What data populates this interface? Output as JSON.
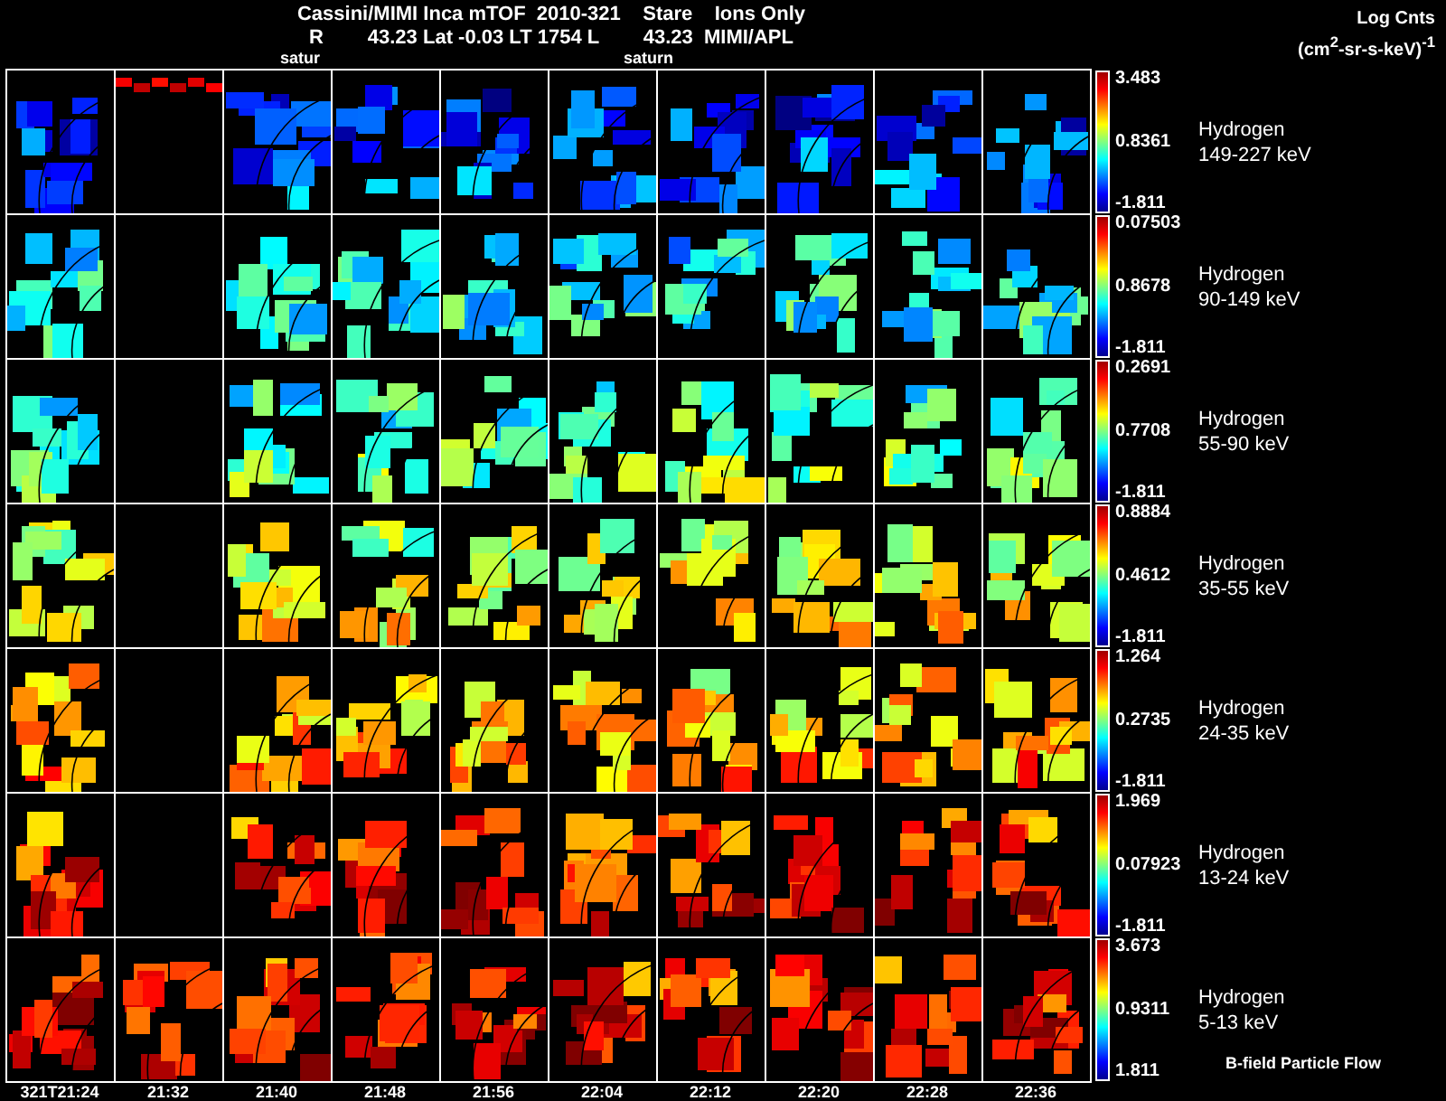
{
  "title": {
    "line1": "Cassini/MIMI Inca mTOF  2010-321    Stare    Ions Only",
    "line2": "R        43.23 Lat -0.03 LT 1754 L        43.23  MIMI/APL",
    "overlays": [
      "satur",
      "saturn"
    ]
  },
  "units": {
    "label": "Log Cnts",
    "unit": "(cm$^{2}$-sr-s-keV)$^{-1}$"
  },
  "rows": [
    {
      "species": "Hydrogen",
      "energy": "149-227 keV",
      "scale_max": "3.483",
      "scale_mid": "0.8361",
      "scale_min": "-1.811",
      "panels": [
        {
          "kind": "full"
        },
        {
          "kind": "strip"
        },
        {
          "kind": "full"
        },
        {
          "kind": "full"
        },
        {
          "kind": "full"
        },
        {
          "kind": "full"
        },
        {
          "kind": "full"
        },
        {
          "kind": "full"
        },
        {
          "kind": "full"
        },
        {
          "kind": "full"
        }
      ]
    },
    {
      "species": "Hydrogen",
      "energy": "90-149 keV",
      "scale_max": "0.07503",
      "scale_mid": "0.8678",
      "scale_min": "-1.811",
      "panels": [
        {
          "kind": "full"
        },
        {
          "kind": "empty"
        },
        {
          "kind": "full"
        },
        {
          "kind": "full"
        },
        {
          "kind": "full"
        },
        {
          "kind": "full"
        },
        {
          "kind": "full"
        },
        {
          "kind": "full"
        },
        {
          "kind": "full"
        },
        {
          "kind": "full"
        }
      ]
    },
    {
      "species": "Hydrogen",
      "energy": "55-90 keV",
      "scale_max": "0.2691",
      "scale_mid": "0.7708",
      "scale_min": "-1.811",
      "panels": [
        {
          "kind": "full"
        },
        {
          "kind": "empty"
        },
        {
          "kind": "full"
        },
        {
          "kind": "full"
        },
        {
          "kind": "full"
        },
        {
          "kind": "full"
        },
        {
          "kind": "full"
        },
        {
          "kind": "full"
        },
        {
          "kind": "full"
        },
        {
          "kind": "full"
        }
      ]
    },
    {
      "species": "Hydrogen",
      "energy": "35-55 keV",
      "scale_max": "0.8884",
      "scale_mid": "0.4612",
      "scale_min": "-1.811",
      "panels": [
        {
          "kind": "full"
        },
        {
          "kind": "empty"
        },
        {
          "kind": "full"
        },
        {
          "kind": "full"
        },
        {
          "kind": "full"
        },
        {
          "kind": "full"
        },
        {
          "kind": "full"
        },
        {
          "kind": "full"
        },
        {
          "kind": "full"
        },
        {
          "kind": "full"
        }
      ]
    },
    {
      "species": "Hydrogen",
      "energy": "24-35 keV",
      "scale_max": "1.264",
      "scale_mid": "0.2735",
      "scale_min": "-1.811",
      "panels": [
        {
          "kind": "full"
        },
        {
          "kind": "empty"
        },
        {
          "kind": "full"
        },
        {
          "kind": "full"
        },
        {
          "kind": "full"
        },
        {
          "kind": "full"
        },
        {
          "kind": "full"
        },
        {
          "kind": "full"
        },
        {
          "kind": "full"
        },
        {
          "kind": "full"
        }
      ]
    },
    {
      "species": "Hydrogen",
      "energy": "13-24 keV",
      "scale_max": "1.969",
      "scale_mid": "0.07923",
      "scale_min": "-1.811",
      "panels": [
        {
          "kind": "full"
        },
        {
          "kind": "empty"
        },
        {
          "kind": "full"
        },
        {
          "kind": "full"
        },
        {
          "kind": "full"
        },
        {
          "kind": "full"
        },
        {
          "kind": "full"
        },
        {
          "kind": "full"
        },
        {
          "kind": "full"
        },
        {
          "kind": "full"
        }
      ]
    },
    {
      "species": "Hydrogen",
      "energy": "5-13 keV",
      "scale_max": "3.673",
      "scale_mid": "0.9311",
      "scale_min": "1.811",
      "panels": [
        {
          "kind": "full"
        },
        {
          "kind": "full"
        },
        {
          "kind": "full"
        },
        {
          "kind": "full"
        },
        {
          "kind": "full"
        },
        {
          "kind": "full"
        },
        {
          "kind": "full"
        },
        {
          "kind": "full"
        },
        {
          "kind": "full"
        },
        {
          "kind": "full"
        }
      ]
    }
  ],
  "footnote": "B-field Particle Flow",
  "times": [
    "321T21:24",
    "21:32",
    "21:40",
    "21:48",
    "21:56",
    "22:04",
    "22:12",
    "22:20",
    "22:28",
    "22:36"
  ]
}
